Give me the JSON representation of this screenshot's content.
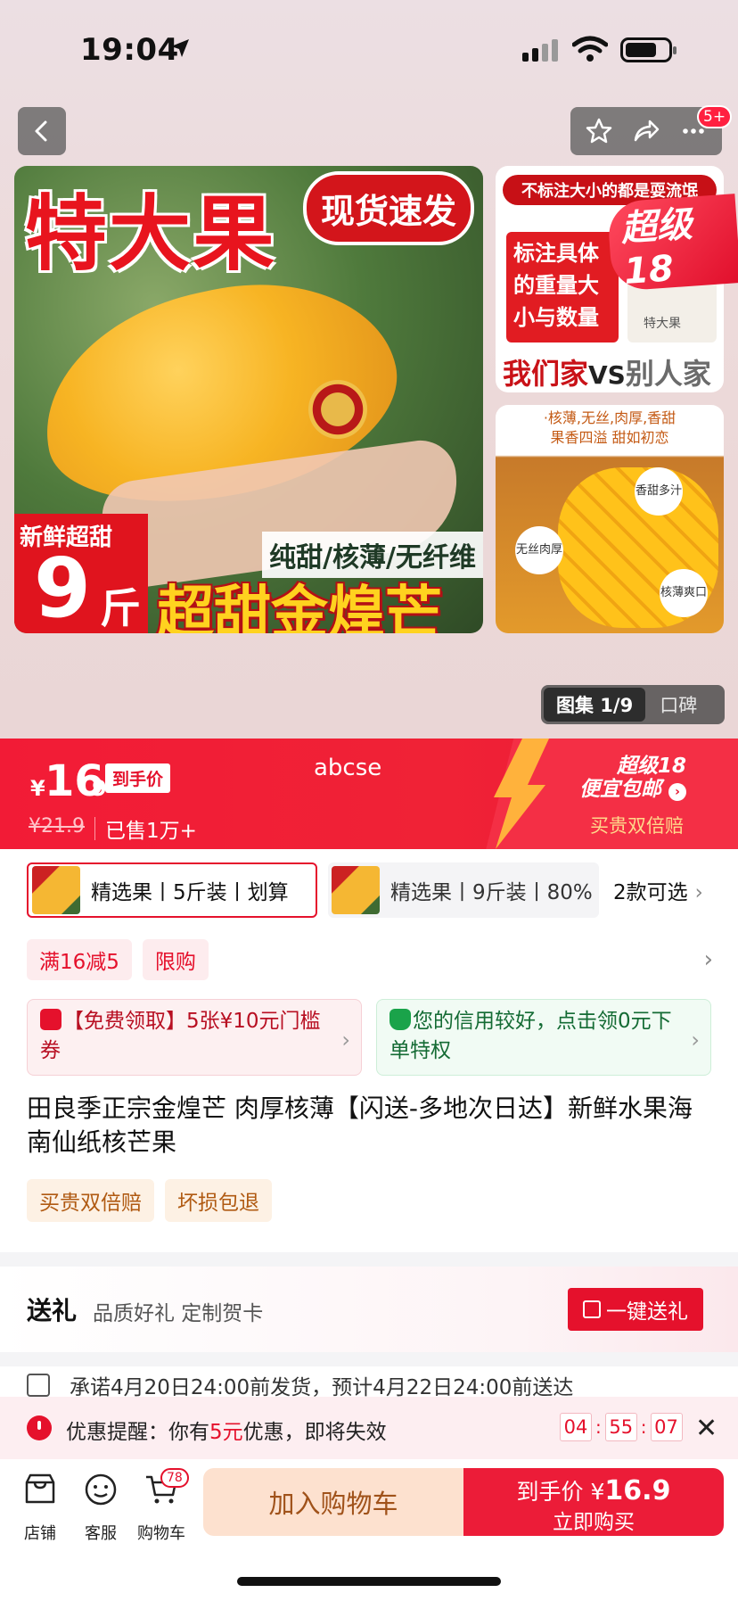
{
  "status_bar": {
    "time": "19:04"
  },
  "nav": {
    "cart_badge": "5+"
  },
  "gallery": {
    "main": {
      "title": "特大果",
      "tag": "现货速发",
      "weight_sub": "新鲜超甜",
      "weight_num": "9",
      "weight_unit": "斤",
      "features": "纯甜/核薄/无纤维",
      "name": "超甜金煌芒"
    },
    "thumb1": {
      "header": "不标注大小的都是耍流氓",
      "box": "标注具体的重量大小与数量",
      "cmp_ours": "我们家",
      "cmp_vs": "VS",
      "cmp_other": "别人家",
      "small_label": "特大果"
    },
    "super_ribbon": "超级18",
    "thumb2": {
      "line1": "·核薄,无丝,肉厚,香甜",
      "line2": "果香四溢 甜如初恋",
      "chip1": "香甜多汁",
      "chip2": "无丝肉厚",
      "chip3": "核薄爽口"
    },
    "switch": {
      "active": "图集 1/9",
      "other": "口碑"
    }
  },
  "price_bar": {
    "currency": "¥",
    "price_int": "16",
    "price_dec": ".9",
    "price_tag": "到手价",
    "original": "¥21.9",
    "sold": "已售1万+",
    "username": "abcse",
    "super_line1": "超级18",
    "super_line2": "便宜包邮",
    "super_sub": "买贵双倍赔"
  },
  "variants": {
    "items": [
      {
        "label": "精选果丨5斤装丨划算"
      },
      {
        "label": "精选果丨9斤装丨80%"
      }
    ],
    "more": "2款可选"
  },
  "promos": [
    "满16减5",
    "限购"
  ],
  "coupons": {
    "red": "【免费领取】5张¥10元门槛券",
    "green": "您的信用较好，点击领0元下单特权"
  },
  "product_title": "田良季正宗金煌芒 肉厚核薄【闪送-多地次日达】新鲜水果海南仙纸核芒果",
  "guarantees": [
    "买贵双倍赔",
    "坏损包退"
  ],
  "gift": {
    "title": "送礼",
    "subtitle": "品质好礼 定制贺卡",
    "button": "一键送礼"
  },
  "delivery": "承诺4月20日24:00前发货，预计4月22日24:00前送达",
  "reminder": {
    "prefix": "优惠提醒：你有",
    "amount": "5元",
    "suffix": "优惠，即将失效",
    "timer": [
      "04",
      "55",
      "07"
    ]
  },
  "bottom_bar": {
    "shop": "店铺",
    "service": "客服",
    "cart": "购物车",
    "cart_count": "78",
    "add_to_cart": "加入购物车",
    "buy_top": "到手价",
    "buy_currency": "¥",
    "buy_price": "16.9",
    "buy_sub": "立即购买"
  },
  "colors": {
    "brand_red": "#e5112c",
    "cart_button_bg": "#fde1cf"
  }
}
